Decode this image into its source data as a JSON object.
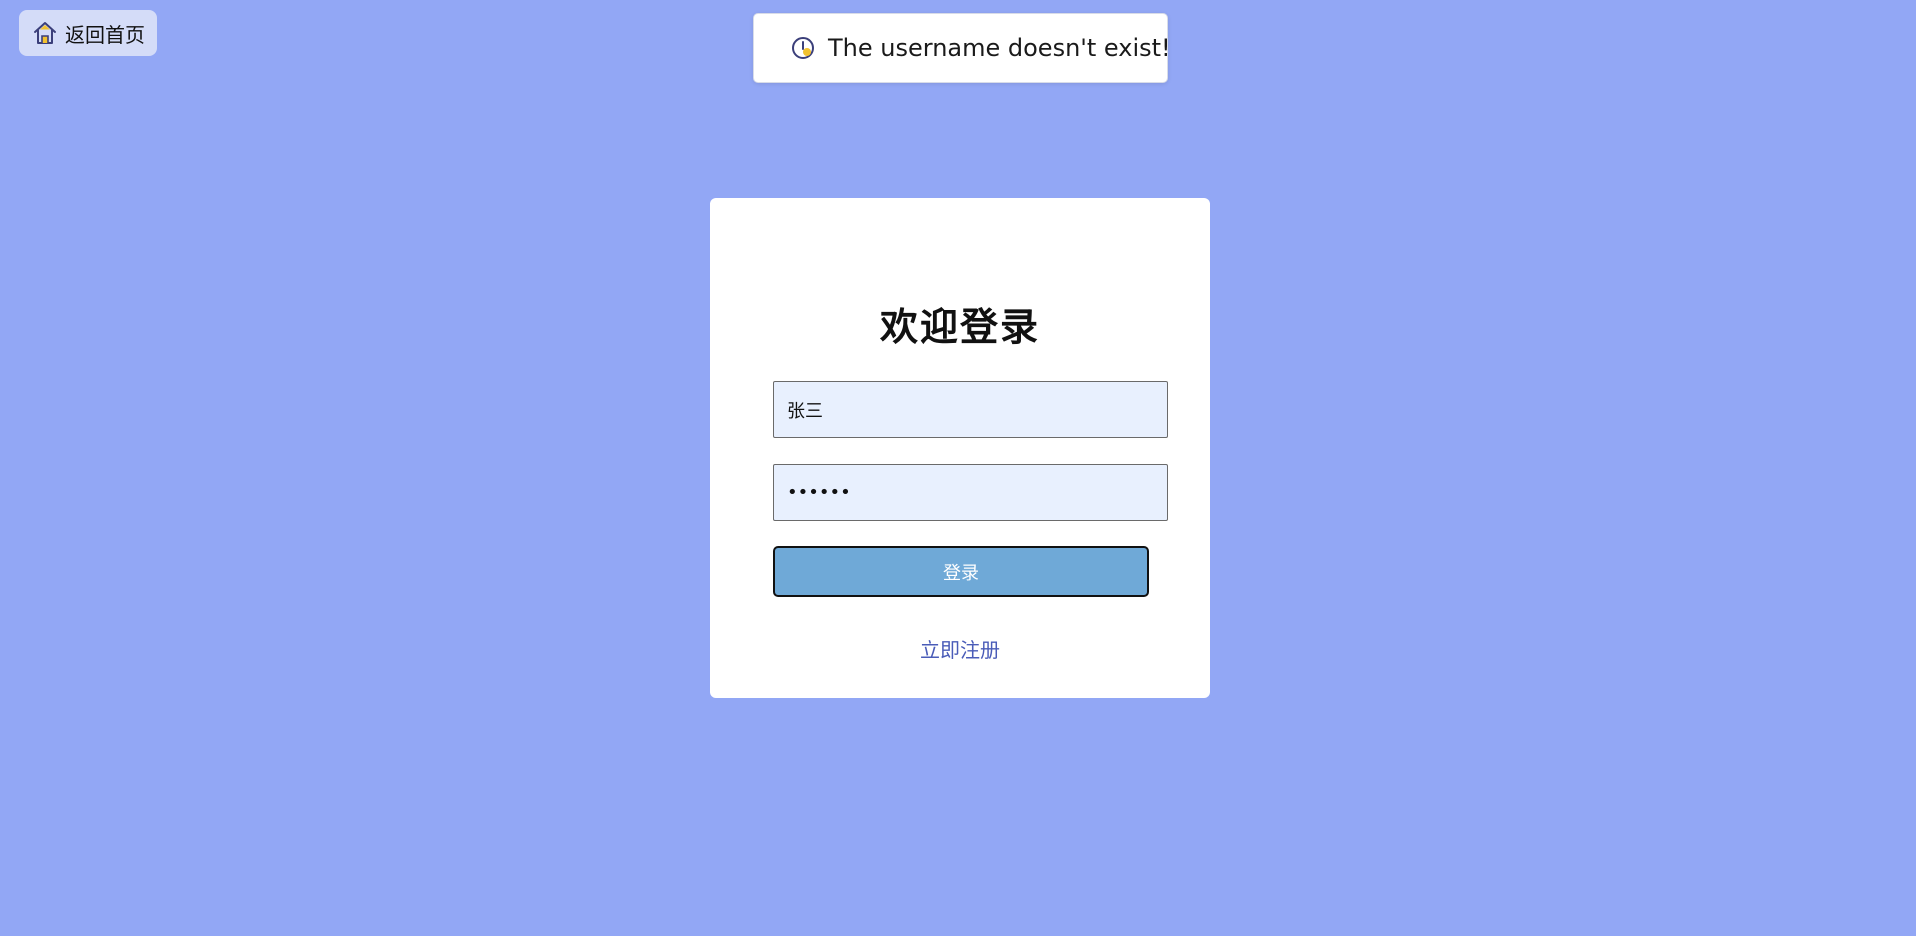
{
  "nav": {
    "home_label": "返回首页",
    "home_icon": "home-icon"
  },
  "toast": {
    "icon": "warning-icon",
    "message": "The username doesn't exist!"
  },
  "login": {
    "title": "欢迎登录",
    "username_value": "张三",
    "password_value": "••••••",
    "submit_label": "登录",
    "register_link": "立即注册"
  },
  "colors": {
    "background": "#92a7f5",
    "card": "#ffffff",
    "button": "#6fa9d7",
    "input_bg": "#e8f0fe",
    "link": "#4a5cb8"
  }
}
